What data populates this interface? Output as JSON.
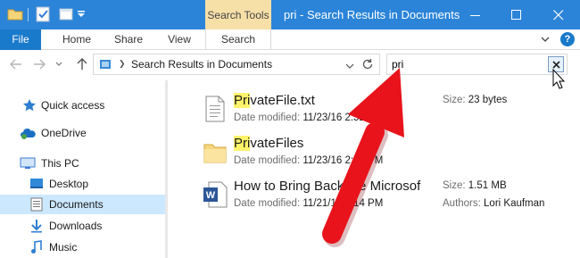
{
  "titlebar": {
    "contextual_tab": "Search Tools",
    "window_title": "pri - Search Results in Documents"
  },
  "ribbon": {
    "tabs": [
      "File",
      "Home",
      "Share",
      "View",
      "Search"
    ],
    "help": "?"
  },
  "address": {
    "path": "Search Results in Documents"
  },
  "search": {
    "value": "pri"
  },
  "nav_pane": {
    "items": [
      {
        "label": "Quick access",
        "icon": "star-icon"
      },
      {
        "label": "OneDrive",
        "icon": "cloud-icon"
      },
      {
        "label": "This PC",
        "icon": "computer-icon"
      },
      {
        "label": "Desktop",
        "icon": "desktop-folder-icon"
      },
      {
        "label": "Documents",
        "icon": "documents-folder-icon",
        "selected": true
      },
      {
        "label": "Downloads",
        "icon": "downloads-icon"
      },
      {
        "label": "Music",
        "icon": "music-icon"
      }
    ]
  },
  "files": [
    {
      "name_highlight": "Pri",
      "name_rest": "vateFile.txt",
      "modified_label": "Date modified:",
      "modified_value": "11/23/16 2:52",
      "size_label": "Size:",
      "size_value": "23 bytes",
      "icon": "text-file-icon"
    },
    {
      "name_highlight": "Pri",
      "name_rest": "vateFiles",
      "modified_label": "Date modified:",
      "modified_value": "11/23/16 2:53 PM",
      "icon": "folder-icon"
    },
    {
      "name_highlight": "",
      "name_rest": "How to Bring Back the Microsof",
      "modified_label": "Date modified:",
      "modified_value": "11/21/16 3:14 PM",
      "size_label": "Size:",
      "size_value": "1.51 MB",
      "authors_label": "Authors:",
      "authors_value": "Lori Kaufman",
      "icon": "word-document-icon"
    }
  ],
  "colors": {
    "titlebar": "#2b84d8",
    "file_tab": "#1979ca",
    "search_tools": "#f7e0a8",
    "selection": "#cce8ff",
    "highlight": "#fff36b",
    "arrow": "#e8131b"
  }
}
